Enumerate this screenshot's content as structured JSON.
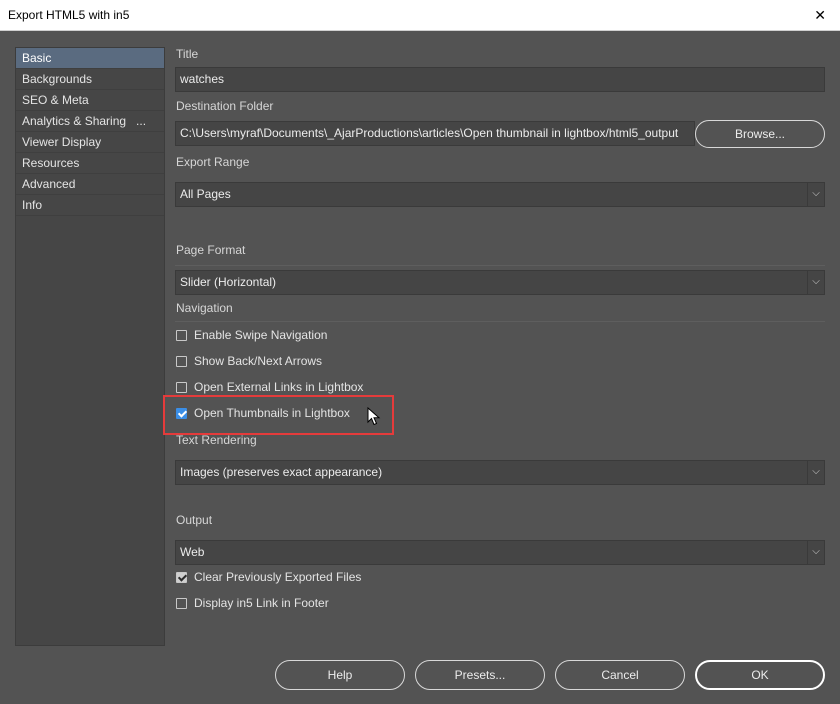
{
  "window": {
    "title": "Export HTML5 with in5",
    "close": "✕"
  },
  "sidebar": {
    "items": [
      {
        "label": "Basic"
      },
      {
        "label": "Backgrounds"
      },
      {
        "label": "SEO & Meta"
      },
      {
        "label": "Analytics & Sharing   ..."
      },
      {
        "label": "Viewer Display"
      },
      {
        "label": "Resources"
      },
      {
        "label": "Advanced"
      },
      {
        "label": "Info"
      }
    ]
  },
  "form": {
    "title_label": "Title",
    "title_value": "watches",
    "dest_label": "Destination Folder",
    "dest_value": "C:\\Users\\myraf\\Documents\\_AjarProductions\\articles\\Open thumbnail in lightbox/html5_output",
    "browse_label": "Browse...",
    "export_range_label": "Export Range",
    "export_range_value": "All Pages",
    "page_format_label": "Page Format",
    "page_format_value": "Slider (Horizontal)",
    "navigation_label": "Navigation",
    "nav_options": {
      "swipe": {
        "label": "Enable Swipe Navigation",
        "checked": false
      },
      "arrows": {
        "label": "Show Back/Next Arrows",
        "checked": false
      },
      "external": {
        "label": "Open External Links in Lightbox",
        "checked": false
      },
      "thumbnails": {
        "label": "Open Thumbnails in Lightbox",
        "checked": true
      }
    },
    "text_rendering_label": "Text Rendering",
    "text_rendering_value": "Images (preserves exact appearance)",
    "output_label": "Output",
    "output_value": "Web",
    "output_options": {
      "clear": {
        "label": "Clear Previously Exported Files",
        "checked": true
      },
      "in5link": {
        "label": "Display in5 Link in Footer",
        "checked": false
      }
    }
  },
  "buttons": {
    "help": "Help",
    "presets": "Presets...",
    "cancel": "Cancel",
    "ok": "OK"
  },
  "colors": {
    "highlight": "#e53b3b",
    "checkbox_blue": "#3b8ee6",
    "selected_sidebar": "#5a6b80"
  }
}
